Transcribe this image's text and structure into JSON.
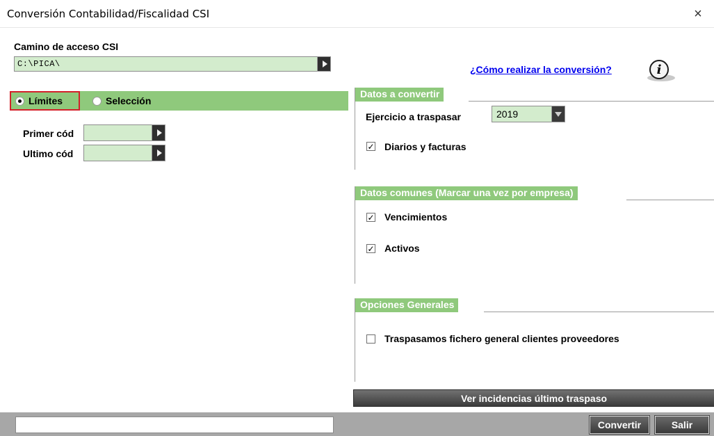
{
  "window": {
    "title": "Conversión Contabilidad/Fiscalidad CSI",
    "close_icon": "×"
  },
  "path": {
    "label": "Camino de acceso CSI",
    "value": "C:\\PICA\\"
  },
  "mode": {
    "options": [
      {
        "label": "Límites",
        "selected": true
      },
      {
        "label": "Selección",
        "selected": false
      }
    ]
  },
  "codes": {
    "first_label": "Primer cód",
    "first_value": "",
    "last_label": "Ultimo cód",
    "last_value": ""
  },
  "help": {
    "link_text": "¿Cómo realizar la conversión?",
    "icon": "info-icon"
  },
  "datos_convertir": {
    "title": "Datos a convertir",
    "ejercicio_label": "Ejercicio a traspasar",
    "ejercicio_value": "2019",
    "diarios_label": "Diarios y facturas",
    "diarios_checked": true
  },
  "datos_comunes": {
    "title": "Datos comunes (Marcar una vez por empresa)",
    "vencimientos_label": "Vencimientos",
    "vencimientos_checked": true,
    "activos_label": "Activos",
    "activos_checked": true
  },
  "opciones": {
    "title": "Opciones Generales",
    "traspasamos_label": "Traspasamos fichero general clientes proveedores",
    "traspasamos_checked": false
  },
  "buttons": {
    "incidencias": "Ver incidencias último traspaso",
    "convertir": "Convertir",
    "salir": "Salir"
  },
  "status": {
    "value": ""
  },
  "colors": {
    "accent_green": "#8fc97c",
    "field_green": "#d3eccd",
    "highlight_red": "#d4202a",
    "link_blue": "#0000ee"
  }
}
